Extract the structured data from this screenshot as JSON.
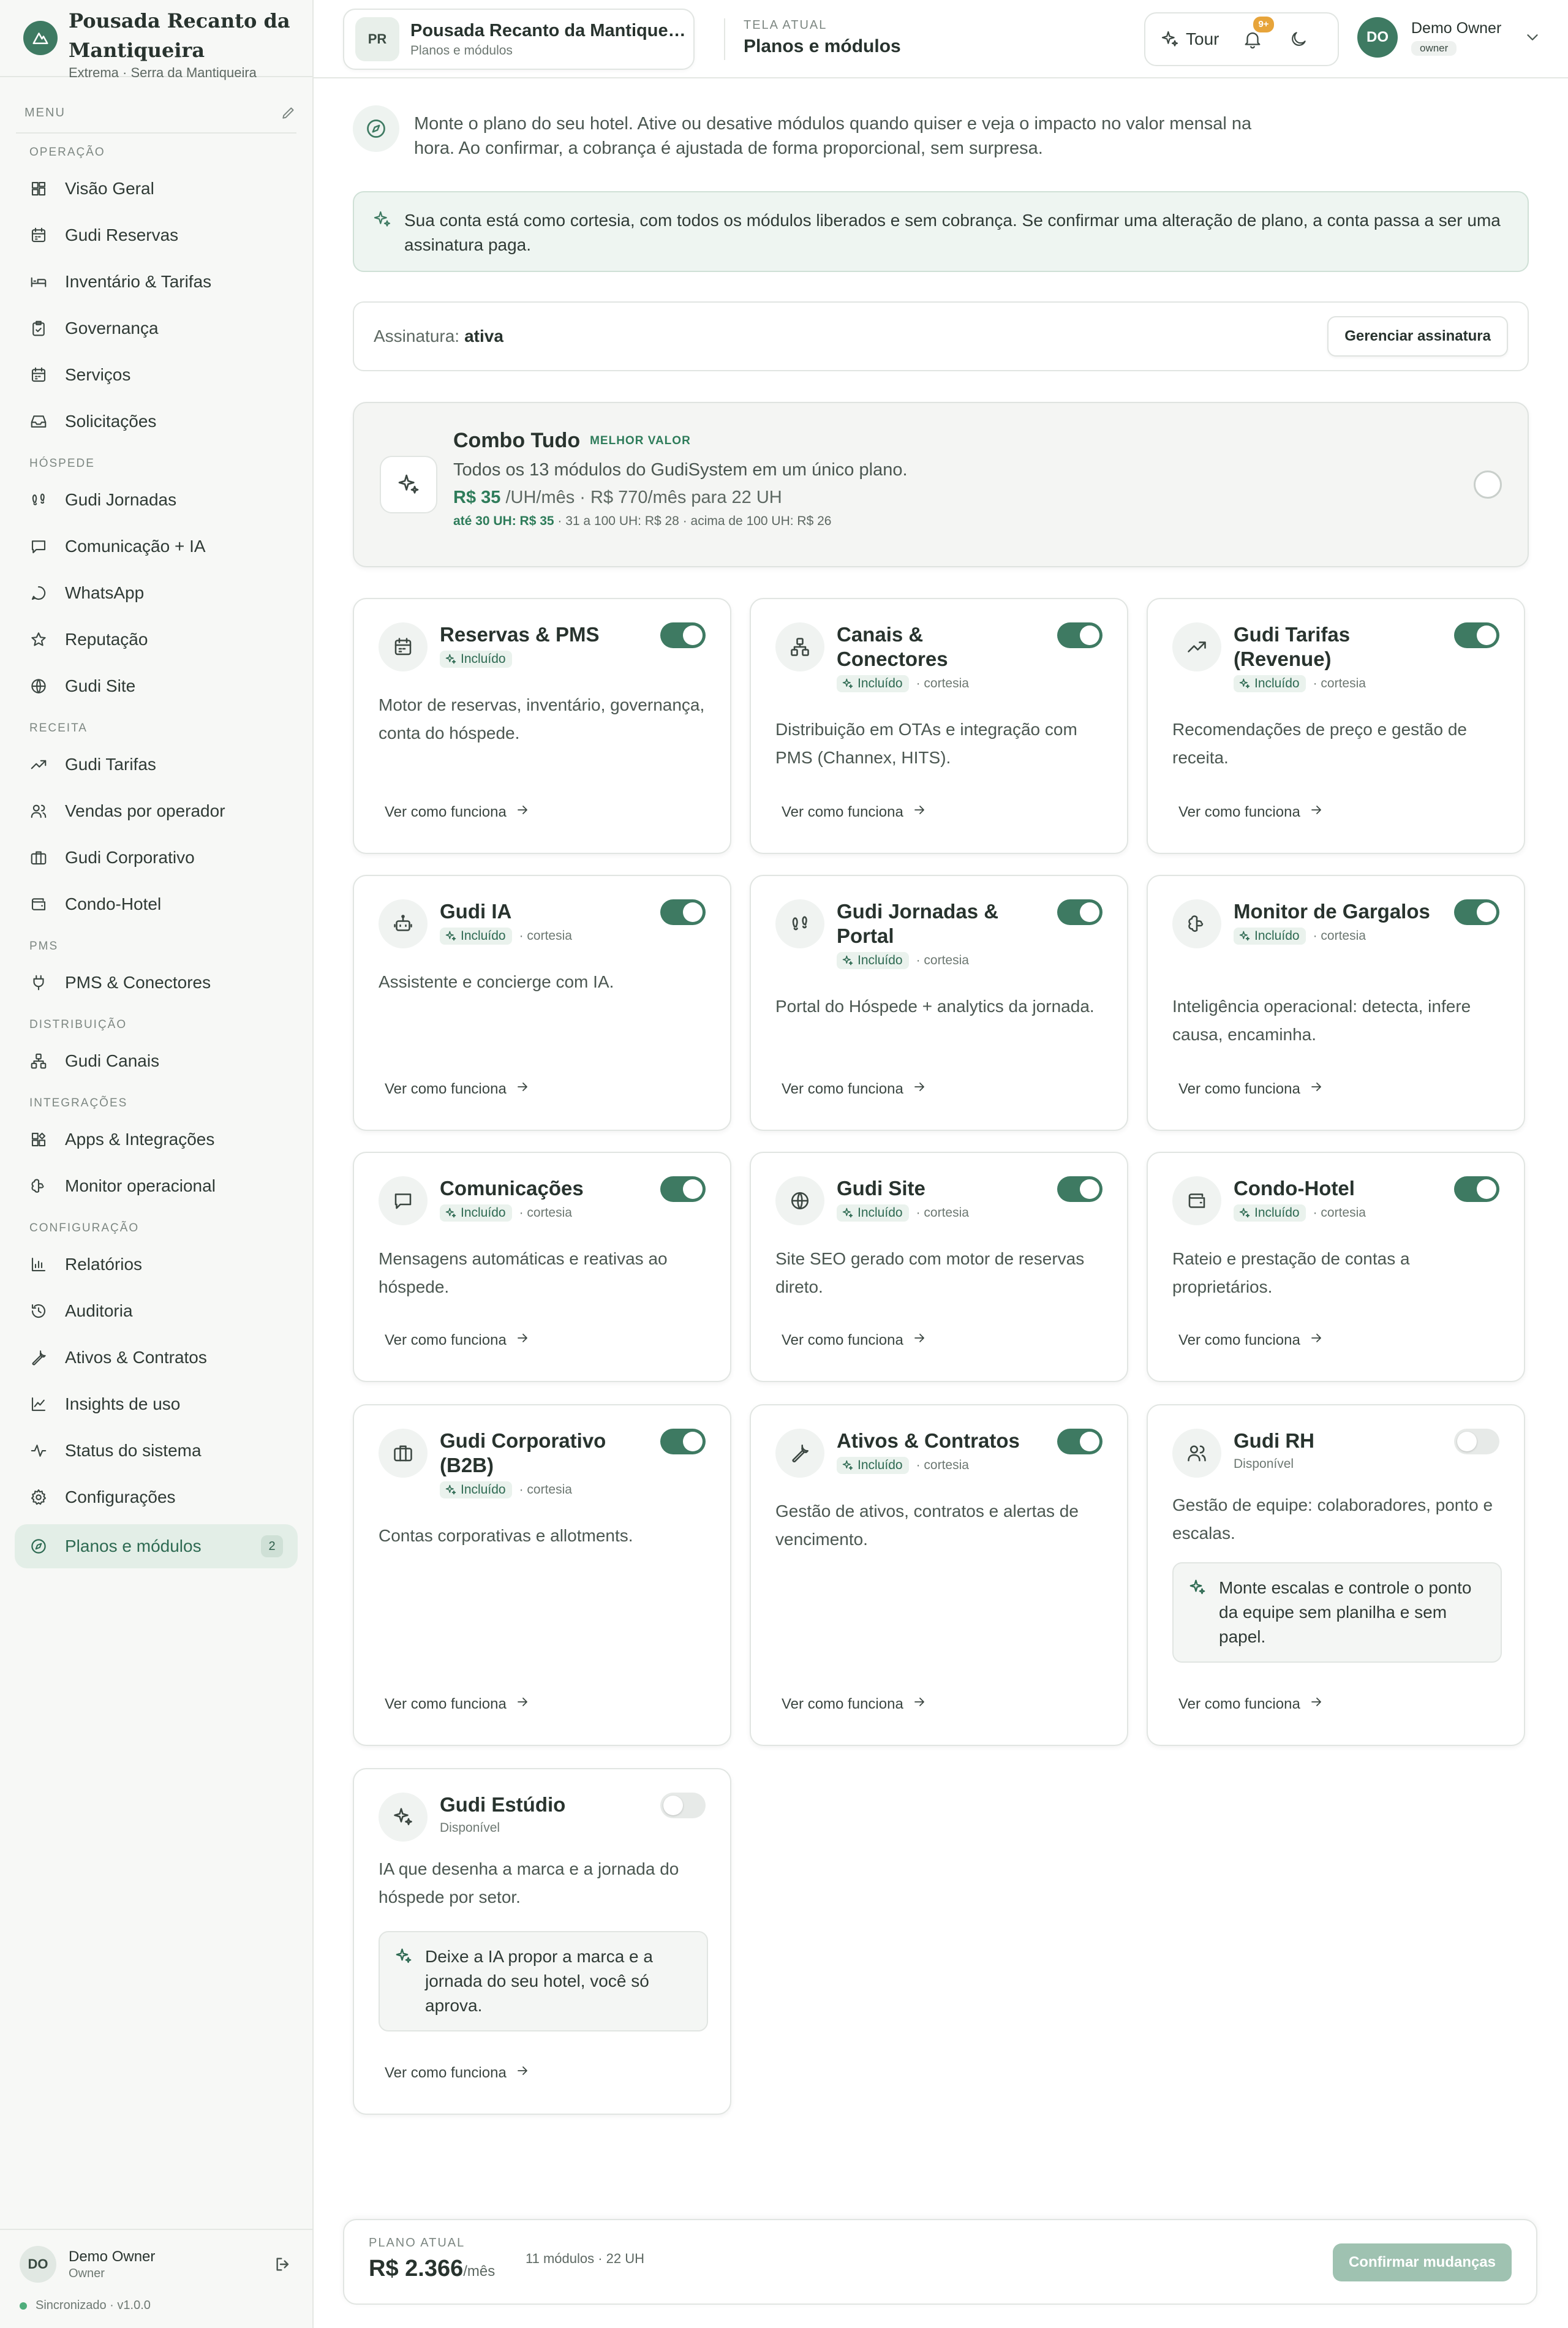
{
  "brand": {
    "name": "Pousada Recanto da Mantiqueira",
    "sub": "Extrema · Serra da Mantiqueira"
  },
  "menu_label": "MENU",
  "nav": [
    {
      "section": "OPERAÇÃO",
      "items": [
        {
          "label": "Visão Geral",
          "icon": "grid-icon"
        },
        {
          "label": "Gudi Reservas",
          "icon": "calendar-icon"
        },
        {
          "label": "Inventário & Tarifas",
          "icon": "bed-icon"
        },
        {
          "label": "Governança",
          "icon": "clipboard-icon"
        },
        {
          "label": "Serviços",
          "icon": "calendar-icon"
        },
        {
          "label": "Solicitações",
          "icon": "inbox-icon"
        }
      ]
    },
    {
      "section": "HÓSPEDE",
      "items": [
        {
          "label": "Gudi Jornadas",
          "icon": "footprints-icon"
        },
        {
          "label": "Comunicação + IA",
          "icon": "message-icon"
        },
        {
          "label": "WhatsApp",
          "icon": "chat-bubble-icon"
        },
        {
          "label": "Reputação",
          "icon": "star-icon"
        },
        {
          "label": "Gudi Site",
          "icon": "globe-icon"
        }
      ]
    },
    {
      "section": "RECEITA",
      "items": [
        {
          "label": "Gudi Tarifas",
          "icon": "trending-up-icon"
        },
        {
          "label": "Vendas por operador",
          "icon": "users-icon"
        },
        {
          "label": "Gudi Corporativo",
          "icon": "briefcase-icon"
        },
        {
          "label": "Condo-Hotel",
          "icon": "wallet-icon"
        }
      ]
    },
    {
      "section": "PMS",
      "items": [
        {
          "label": "PMS & Conectores",
          "icon": "plug-icon"
        }
      ]
    },
    {
      "section": "DISTRIBUIÇÃO",
      "items": [
        {
          "label": "Gudi Canais",
          "icon": "network-icon"
        }
      ]
    },
    {
      "section": "INTEGRAÇÕES",
      "items": [
        {
          "label": "Apps & Integrações",
          "icon": "puzzle-icon"
        },
        {
          "label": "Monitor operacional",
          "icon": "brain-icon"
        }
      ]
    },
    {
      "section": "CONFIGURAÇÃO",
      "items": [
        {
          "label": "Relatórios",
          "icon": "bar-chart-icon"
        },
        {
          "label": "Auditoria",
          "icon": "history-icon"
        },
        {
          "label": "Ativos & Contratos",
          "icon": "wrench-icon"
        },
        {
          "label": "Insights de uso",
          "icon": "line-chart-icon"
        },
        {
          "label": "Status do sistema",
          "icon": "activity-icon"
        },
        {
          "label": "Configurações",
          "icon": "gear-icon"
        }
      ]
    }
  ],
  "active_nav": {
    "label": "Planos e módulos",
    "count": "2",
    "icon": "compass-icon"
  },
  "sidebar_user": {
    "initials": "DO",
    "name": "Demo Owner",
    "role": "Owner",
    "sync": "Sincronizado · v1.0.0"
  },
  "topbar": {
    "property_initials": "PR",
    "property_name": "Pousada Recanto da Mantiqueira",
    "property_sub": "Planos e módulos",
    "screen_label": "TELA ATUAL",
    "screen_value": "Planos e módulos",
    "tour_label": "Tour",
    "notif_badge": "9+",
    "user_initials": "DO",
    "user_name": "Demo Owner",
    "user_role": "owner"
  },
  "intro": "Monte o plano do seu hotel. Ative ou desative módulos quando quiser e veja o impacto no valor mensal na hora. Ao confirmar, a cobrança é ajustada de forma proporcional, sem surpresa.",
  "courtesy_notice": "Sua conta está como cortesia, com todos os módulos liberados e sem cobrança. Se confirmar uma alteração de plano, a conta passa a ser uma assinatura paga.",
  "subscription": {
    "label": "Assinatura:",
    "status": "ativa",
    "button": "Gerenciar assinatura"
  },
  "combo": {
    "title": "Combo Tudo",
    "badge": "MELHOR VALOR",
    "desc": "Todos os 13 módulos do GudiSystem em um único plano.",
    "price_main": "R$ 35",
    "price_rest": " /UH/mês · R$ 770/mês para 22 UH",
    "tier1": "até 30 UH: R$ 35",
    "tier_rest": " · 31 a 100 UH: R$ 28 · acima de 100 UH: R$ 26"
  },
  "included_label": "Incluído",
  "courtesy_label": "· cortesia",
  "available_label": "Disponível",
  "more_label": "Ver como funciona",
  "modules": [
    {
      "name": "Reservas & PMS",
      "icon": "calendar-icon",
      "desc": "Motor de reservas, inventário, governança, conta do hóspede.",
      "on": true,
      "courtesy": false
    },
    {
      "name": "Canais & Conectores",
      "icon": "network-icon",
      "desc": "Distribuição em OTAs e integração com PMS (Channex, HITS).",
      "on": true,
      "courtesy": true
    },
    {
      "name": "Gudi Tarifas (Revenue)",
      "icon": "trending-up-icon",
      "desc": "Recomendações de preço e gestão de receita.",
      "on": true,
      "courtesy": true
    },
    {
      "name": "Gudi IA",
      "icon": "bot-icon",
      "desc": "Assistente e concierge com IA.",
      "on": true,
      "courtesy": true
    },
    {
      "name": "Gudi Jornadas & Portal",
      "icon": "footprints-icon",
      "desc": "Portal do Hóspede + analytics da jornada.",
      "on": true,
      "courtesy": true
    },
    {
      "name": "Monitor de Gargalos",
      "icon": "brain-icon",
      "desc": "Inteligência operacional: detecta, infere causa, encaminha.",
      "on": true,
      "courtesy": true
    },
    {
      "name": "Comunicações",
      "icon": "message-icon",
      "desc": "Mensagens automáticas e reativas ao hóspede.",
      "on": true,
      "courtesy": true
    },
    {
      "name": "Gudi Site",
      "icon": "globe-icon",
      "desc": "Site SEO gerado com motor de reservas direto.",
      "on": true,
      "courtesy": true
    },
    {
      "name": "Condo-Hotel",
      "icon": "wallet-icon",
      "desc": "Rateio e prestação de contas a proprietários.",
      "on": true,
      "courtesy": true
    },
    {
      "name": "Gudi Corporativo (B2B)",
      "icon": "briefcase-icon",
      "desc": "Contas corporativas e allotments.",
      "on": true,
      "courtesy": true
    },
    {
      "name": "Ativos & Contratos",
      "icon": "wrench-icon",
      "desc": "Gestão de ativos, contratos e alertas de vencimento.",
      "on": true,
      "courtesy": true
    },
    {
      "name": "Gudi RH",
      "icon": "users-icon",
      "desc": "Gestão de equipe: colaboradores, ponto e escalas.",
      "on": false,
      "hint": "Monte escalas e controle o ponto da equipe sem planilha e sem papel."
    },
    {
      "name": "Gudi Estúdio",
      "icon": "sparkles-icon",
      "desc": "IA que desenha a marca e a jornada do hóspede por setor.",
      "on": false,
      "hint": "Deixe a IA propor a marca e a jornada do seu hotel, você só aprova."
    }
  ],
  "plan": {
    "label": "PLANO ATUAL",
    "price": "R$ 2.366",
    "per": "/mês",
    "info": "11 módulos · 22 UH",
    "confirm": "Confirmar mudanças"
  },
  "colors": {
    "accent": "#3e7a62",
    "accent_soft": "#e3eee7",
    "badge": "#e7a43a"
  }
}
